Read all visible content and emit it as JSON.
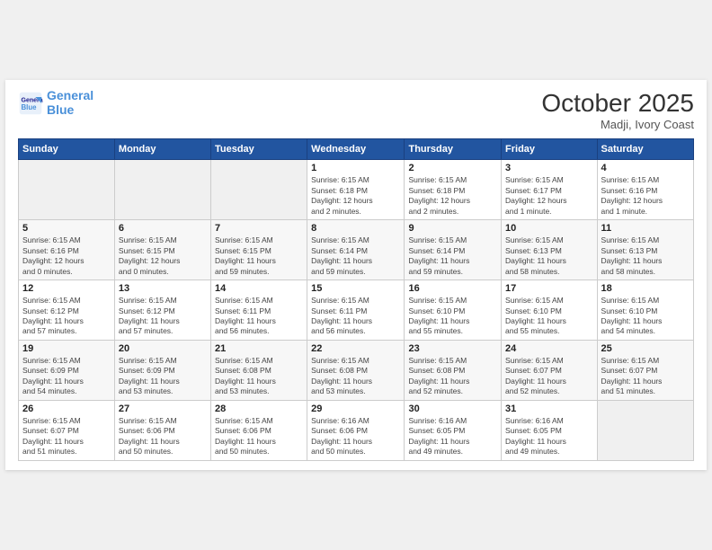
{
  "header": {
    "logo_line1": "General",
    "logo_line2": "Blue",
    "month": "October 2025",
    "location": "Madji, Ivory Coast"
  },
  "weekdays": [
    "Sunday",
    "Monday",
    "Tuesday",
    "Wednesday",
    "Thursday",
    "Friday",
    "Saturday"
  ],
  "weeks": [
    [
      {
        "day": "",
        "detail": ""
      },
      {
        "day": "",
        "detail": ""
      },
      {
        "day": "",
        "detail": ""
      },
      {
        "day": "1",
        "detail": "Sunrise: 6:15 AM\nSunset: 6:18 PM\nDaylight: 12 hours\nand 2 minutes."
      },
      {
        "day": "2",
        "detail": "Sunrise: 6:15 AM\nSunset: 6:18 PM\nDaylight: 12 hours\nand 2 minutes."
      },
      {
        "day": "3",
        "detail": "Sunrise: 6:15 AM\nSunset: 6:17 PM\nDaylight: 12 hours\nand 1 minute."
      },
      {
        "day": "4",
        "detail": "Sunrise: 6:15 AM\nSunset: 6:16 PM\nDaylight: 12 hours\nand 1 minute."
      }
    ],
    [
      {
        "day": "5",
        "detail": "Sunrise: 6:15 AM\nSunset: 6:16 PM\nDaylight: 12 hours\nand 0 minutes."
      },
      {
        "day": "6",
        "detail": "Sunrise: 6:15 AM\nSunset: 6:15 PM\nDaylight: 12 hours\nand 0 minutes."
      },
      {
        "day": "7",
        "detail": "Sunrise: 6:15 AM\nSunset: 6:15 PM\nDaylight: 11 hours\nand 59 minutes."
      },
      {
        "day": "8",
        "detail": "Sunrise: 6:15 AM\nSunset: 6:14 PM\nDaylight: 11 hours\nand 59 minutes."
      },
      {
        "day": "9",
        "detail": "Sunrise: 6:15 AM\nSunset: 6:14 PM\nDaylight: 11 hours\nand 59 minutes."
      },
      {
        "day": "10",
        "detail": "Sunrise: 6:15 AM\nSunset: 6:13 PM\nDaylight: 11 hours\nand 58 minutes."
      },
      {
        "day": "11",
        "detail": "Sunrise: 6:15 AM\nSunset: 6:13 PM\nDaylight: 11 hours\nand 58 minutes."
      }
    ],
    [
      {
        "day": "12",
        "detail": "Sunrise: 6:15 AM\nSunset: 6:12 PM\nDaylight: 11 hours\nand 57 minutes."
      },
      {
        "day": "13",
        "detail": "Sunrise: 6:15 AM\nSunset: 6:12 PM\nDaylight: 11 hours\nand 57 minutes."
      },
      {
        "day": "14",
        "detail": "Sunrise: 6:15 AM\nSunset: 6:11 PM\nDaylight: 11 hours\nand 56 minutes."
      },
      {
        "day": "15",
        "detail": "Sunrise: 6:15 AM\nSunset: 6:11 PM\nDaylight: 11 hours\nand 56 minutes."
      },
      {
        "day": "16",
        "detail": "Sunrise: 6:15 AM\nSunset: 6:10 PM\nDaylight: 11 hours\nand 55 minutes."
      },
      {
        "day": "17",
        "detail": "Sunrise: 6:15 AM\nSunset: 6:10 PM\nDaylight: 11 hours\nand 55 minutes."
      },
      {
        "day": "18",
        "detail": "Sunrise: 6:15 AM\nSunset: 6:10 PM\nDaylight: 11 hours\nand 54 minutes."
      }
    ],
    [
      {
        "day": "19",
        "detail": "Sunrise: 6:15 AM\nSunset: 6:09 PM\nDaylight: 11 hours\nand 54 minutes."
      },
      {
        "day": "20",
        "detail": "Sunrise: 6:15 AM\nSunset: 6:09 PM\nDaylight: 11 hours\nand 53 minutes."
      },
      {
        "day": "21",
        "detail": "Sunrise: 6:15 AM\nSunset: 6:08 PM\nDaylight: 11 hours\nand 53 minutes."
      },
      {
        "day": "22",
        "detail": "Sunrise: 6:15 AM\nSunset: 6:08 PM\nDaylight: 11 hours\nand 53 minutes."
      },
      {
        "day": "23",
        "detail": "Sunrise: 6:15 AM\nSunset: 6:08 PM\nDaylight: 11 hours\nand 52 minutes."
      },
      {
        "day": "24",
        "detail": "Sunrise: 6:15 AM\nSunset: 6:07 PM\nDaylight: 11 hours\nand 52 minutes."
      },
      {
        "day": "25",
        "detail": "Sunrise: 6:15 AM\nSunset: 6:07 PM\nDaylight: 11 hours\nand 51 minutes."
      }
    ],
    [
      {
        "day": "26",
        "detail": "Sunrise: 6:15 AM\nSunset: 6:07 PM\nDaylight: 11 hours\nand 51 minutes."
      },
      {
        "day": "27",
        "detail": "Sunrise: 6:15 AM\nSunset: 6:06 PM\nDaylight: 11 hours\nand 50 minutes."
      },
      {
        "day": "28",
        "detail": "Sunrise: 6:15 AM\nSunset: 6:06 PM\nDaylight: 11 hours\nand 50 minutes."
      },
      {
        "day": "29",
        "detail": "Sunrise: 6:16 AM\nSunset: 6:06 PM\nDaylight: 11 hours\nand 50 minutes."
      },
      {
        "day": "30",
        "detail": "Sunrise: 6:16 AM\nSunset: 6:05 PM\nDaylight: 11 hours\nand 49 minutes."
      },
      {
        "day": "31",
        "detail": "Sunrise: 6:16 AM\nSunset: 6:05 PM\nDaylight: 11 hours\nand 49 minutes."
      },
      {
        "day": "",
        "detail": ""
      }
    ]
  ]
}
